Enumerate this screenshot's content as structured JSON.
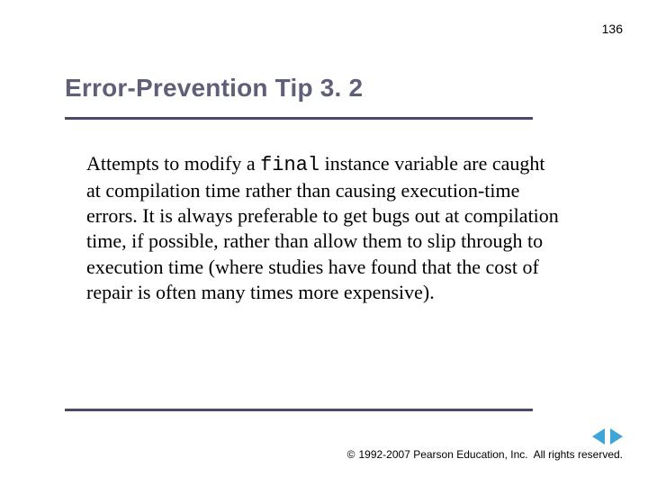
{
  "page_number": "136",
  "title": "Error-Prevention Tip 3. 2",
  "body": {
    "part1": "Attempts to modify a ",
    "code1": "final",
    "part2": " instance variable are caught at compilation time rather than causing execution-time errors. It is always preferable to get bugs out at compilation time, if possible, rather than allow them to slip through to execution time (where studies have found that the cost of repair is often many times more expensive)."
  },
  "footer": {
    "copyright_symbol": "©",
    "copyright_text": " 1992-2007 Pearson Education, Inc.",
    "rights": "All rights reserved."
  },
  "nav": {
    "prev": "previous",
    "next": "next"
  }
}
